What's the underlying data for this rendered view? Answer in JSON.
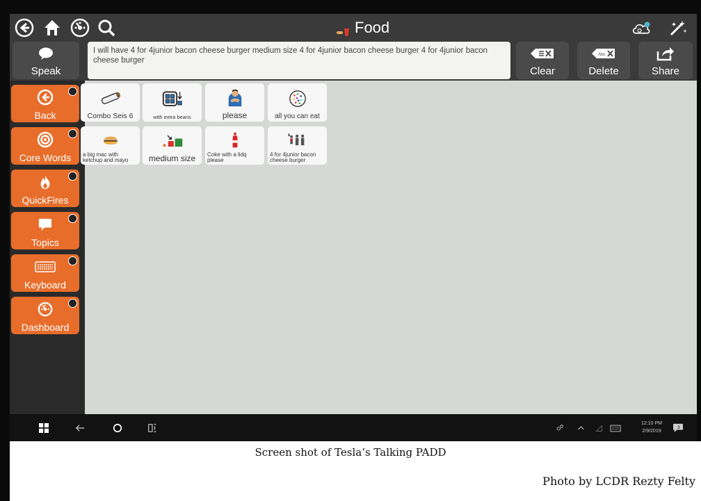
{
  "header": {
    "title": "Food",
    "left_icons": [
      "back-arrow-icon",
      "home-icon",
      "dashboard-icon",
      "search-icon"
    ],
    "right_icons": [
      "cloud-sync-icon",
      "edit-magic-icon"
    ]
  },
  "message": {
    "text": "I will have 4 for 4junior bacon cheese burger medium size 4 for 4junior bacon cheese burger 4 for 4junior bacon cheese burger",
    "speak_label": "Speak",
    "clear_label": "Clear",
    "delete_label": "Delete",
    "share_label": "Share"
  },
  "sidebar": {
    "items": [
      {
        "label": "Back",
        "icon": "back-arrow-icon"
      },
      {
        "label": "Core Words",
        "icon": "target-icon"
      },
      {
        "label": "QuickFires",
        "icon": "flame-icon"
      },
      {
        "label": "Topics",
        "icon": "speech-bubble-icon"
      },
      {
        "label": "Keyboard",
        "icon": "keyboard-icon"
      },
      {
        "label": "Dashboard",
        "icon": "dashboard-icon"
      }
    ]
  },
  "tiles": [
    {
      "label": "Combo Seis 6",
      "icon": "burrito-icon"
    },
    {
      "label": "with extra beans",
      "icon": "beans-grid-icon"
    },
    {
      "label": "please",
      "icon": "please-person-icon"
    },
    {
      "label": "all you can eat",
      "icon": "plate-icon"
    },
    {
      "label": "a big mac with ketchup and mayo",
      "icon": "burger-icon"
    },
    {
      "label": "medium size",
      "icon": "size-icon"
    },
    {
      "label": "Coke with a lidq please",
      "icon": "soda-icon"
    },
    {
      "label": "4 for 4junior bacon cheese burger",
      "icon": "people-icon"
    }
  ],
  "taskbar": {
    "time": "12:10 PM",
    "date": "2/9/2019",
    "notification_count": "3"
  },
  "caption": "Screen shot of Tesla’s Talking PADD",
  "credit": "Photo by LCDR  Rezty Felty",
  "colors": {
    "sidebar_orange": "#e86d2a",
    "bar_dark": "#3a3a3a",
    "grid_bg": "#d6d8d6"
  }
}
